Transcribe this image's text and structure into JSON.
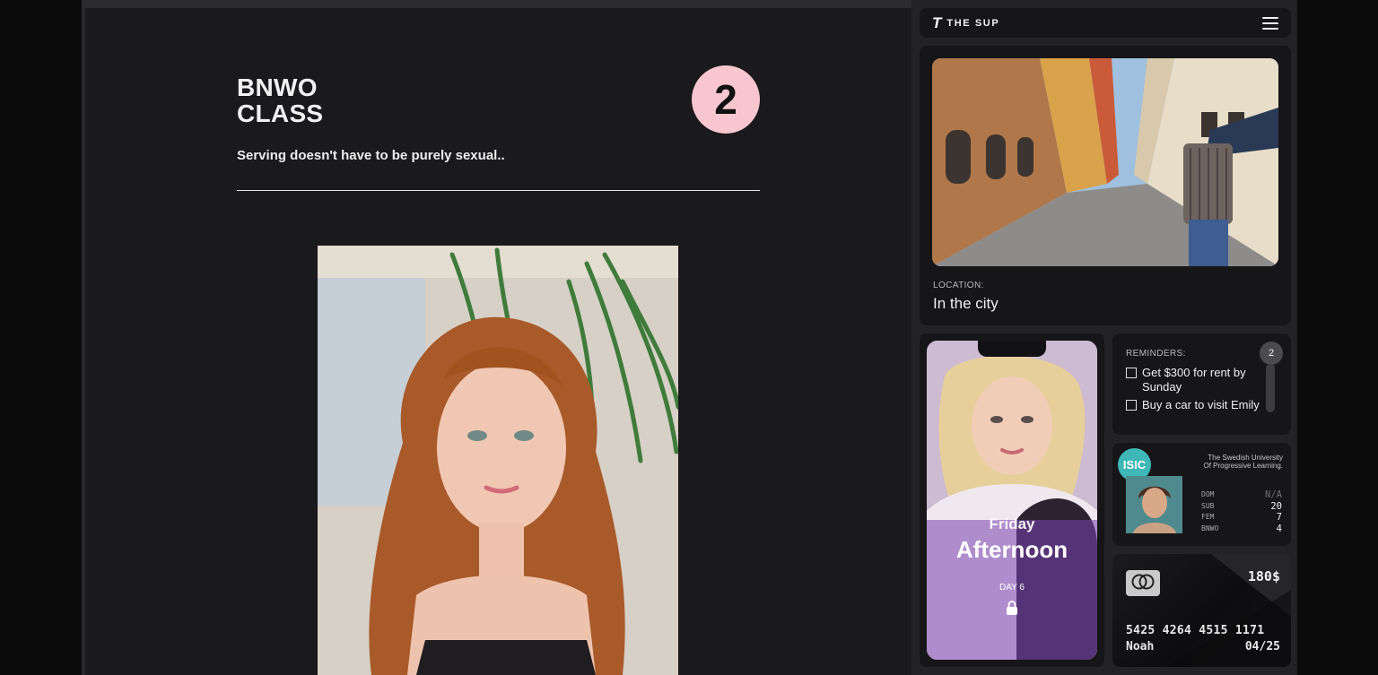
{
  "main": {
    "title_line1": "BNWO",
    "title_line2": "CLASS",
    "class_number": "2",
    "subtitle": "Serving doesn't have to be purely sexual.."
  },
  "header": {
    "brand": "THE SUP",
    "logo_glyph": "T",
    "menu_icon": "hamburger-menu-icon"
  },
  "location": {
    "label": "LOCATION:",
    "value": "In the city"
  },
  "phone": {
    "day": "Friday",
    "time_of_day": "Afternoon",
    "day_number": "DAY 6",
    "lock_icon": "lock-icon"
  },
  "reminders": {
    "label": "REMINDERS:",
    "count": "2",
    "items": [
      {
        "text": "Get $300 for rent by Sunday"
      },
      {
        "text": "Buy a car to visit Emily"
      }
    ]
  },
  "isic": {
    "logo": "ISIC",
    "university_line1": "The Swedish University",
    "university_line2": "Of Progressive Learning.",
    "stats": [
      {
        "key": "DOM",
        "value": "N/A"
      },
      {
        "key": "SUB",
        "value": "20"
      },
      {
        "key": "FEM",
        "value": "7"
      },
      {
        "key": "BNWO",
        "value": "4"
      }
    ]
  },
  "credit_card": {
    "amount": "180$",
    "number": "5425 4264 4515 1171",
    "holder": "Noah",
    "expiry": "04/25",
    "brand_icon": "mastercard-icon"
  },
  "colors": {
    "badge": "#f7c6cf",
    "isic": "#3fb7b7",
    "background": "#1a191c"
  }
}
